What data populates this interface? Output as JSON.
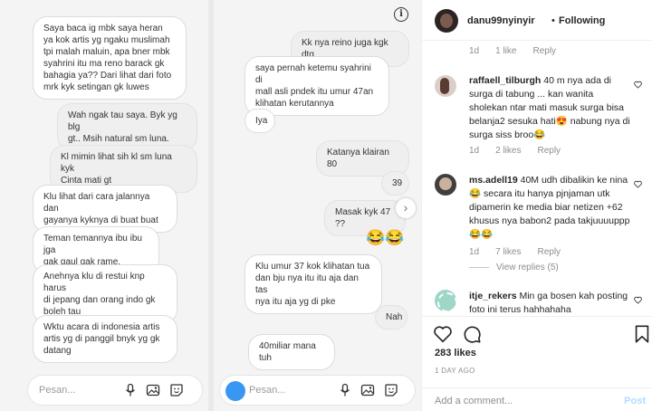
{
  "chat_left": {
    "messages": [
      {
        "text": "Saya baca ig mbk saya heran\nya kok artis yg ngaku muslimah\ntpi malah maluin, apa bner mbk\nsyahrini itu ma reno barack gk\nbahagia ya?? Dari lihat dari foto\nmrk kyk setingan gk luwes"
      },
      {
        "text": "Wah ngak tau saya. Byk yg blg\ngt..  Msih natural sm luna."
      },
      {
        "text": "Kl mimin lihat sih kl sm luna kyk\nCinta mati gt"
      },
      {
        "text": "Klu lihat dari cara jalannya dan\ngayanya kyknya di buat buat"
      },
      {
        "text": "Teman temannya ibu ibu jga\ngak gaul gak rame,"
      },
      {
        "text": "Anehnya klu di restui knp harus\ndi jepang dan orang indo gk\nboleh tau"
      },
      {
        "text": "Wktu acara di indonesia artis\nartis yg di panggil bnyk yg gk\ndatang"
      }
    ],
    "input_placeholder": "Pesan..."
  },
  "chat_right": {
    "messages": [
      {
        "text": "Kk nya reino juga kgk dtg"
      },
      {
        "text": "saya pernah ketemu syahrini di\nmall asli pndek itu umur 47an\nklihatan kerutannya"
      },
      {
        "text": "Iya"
      },
      {
        "text": "Katanya klairan 80"
      },
      {
        "text": "39"
      },
      {
        "text": "Masak kyk 47 ??"
      },
      {
        "text": "😂😂"
      },
      {
        "text": "Klu umur 37  kok klihatan tua\ndan bju nya itu itu aja dan tas\nnya itu aja yg di pke"
      },
      {
        "text": "Nah"
      },
      {
        "text": "40miliar mana tuh"
      }
    ],
    "input_placeholder": "Pesan..."
  },
  "post": {
    "username": "danu99nyinyir",
    "separator": "•",
    "follow_status": "Following"
  },
  "comments": [
    {
      "time": "1d",
      "likes": "1 like",
      "reply": "Reply"
    },
    {
      "user": "raffaell_tilburgh",
      "text": "40 m nya ada di surga di tabung ... kan wanita sholekan ntar mati masuk surga bisa belanja2 sesuka hati😍 nabung nya di surga siss broo😂",
      "time": "1d",
      "likes": "2 likes",
      "reply": "Reply"
    },
    {
      "user": "ms.adell19",
      "text": "40M udh dibalikin ke nina😂 secara itu hanya pjnjaman utk dipamerin ke media biar netizen +62 khusus nya babon2 pada takjuuuuppp😂😂",
      "time": "1d",
      "likes": "7 likes",
      "reply": "Reply",
      "view_replies": "View replies (5)"
    },
    {
      "user": "itje_rekers",
      "text": "Min ga bosen kah posting foto ini terus hahhahaha"
    }
  ],
  "actions": {
    "likes": "283 likes",
    "date": "1 DAY AGO"
  },
  "add_comment": {
    "placeholder": "Add a comment...",
    "post_label": "Post"
  },
  "icons": {
    "info": "info-icon",
    "next": "chevron-right-icon",
    "like": "heart-icon",
    "comment": "comment-icon",
    "save": "bookmark-icon",
    "mic": "microphone-icon",
    "gallery": "image-icon",
    "sticker": "sticker-icon",
    "camera": "camera-icon"
  },
  "colors": {
    "accent": "#3897f0",
    "post_disabled": "#b3dbff",
    "muted": "#8e8e8e"
  }
}
